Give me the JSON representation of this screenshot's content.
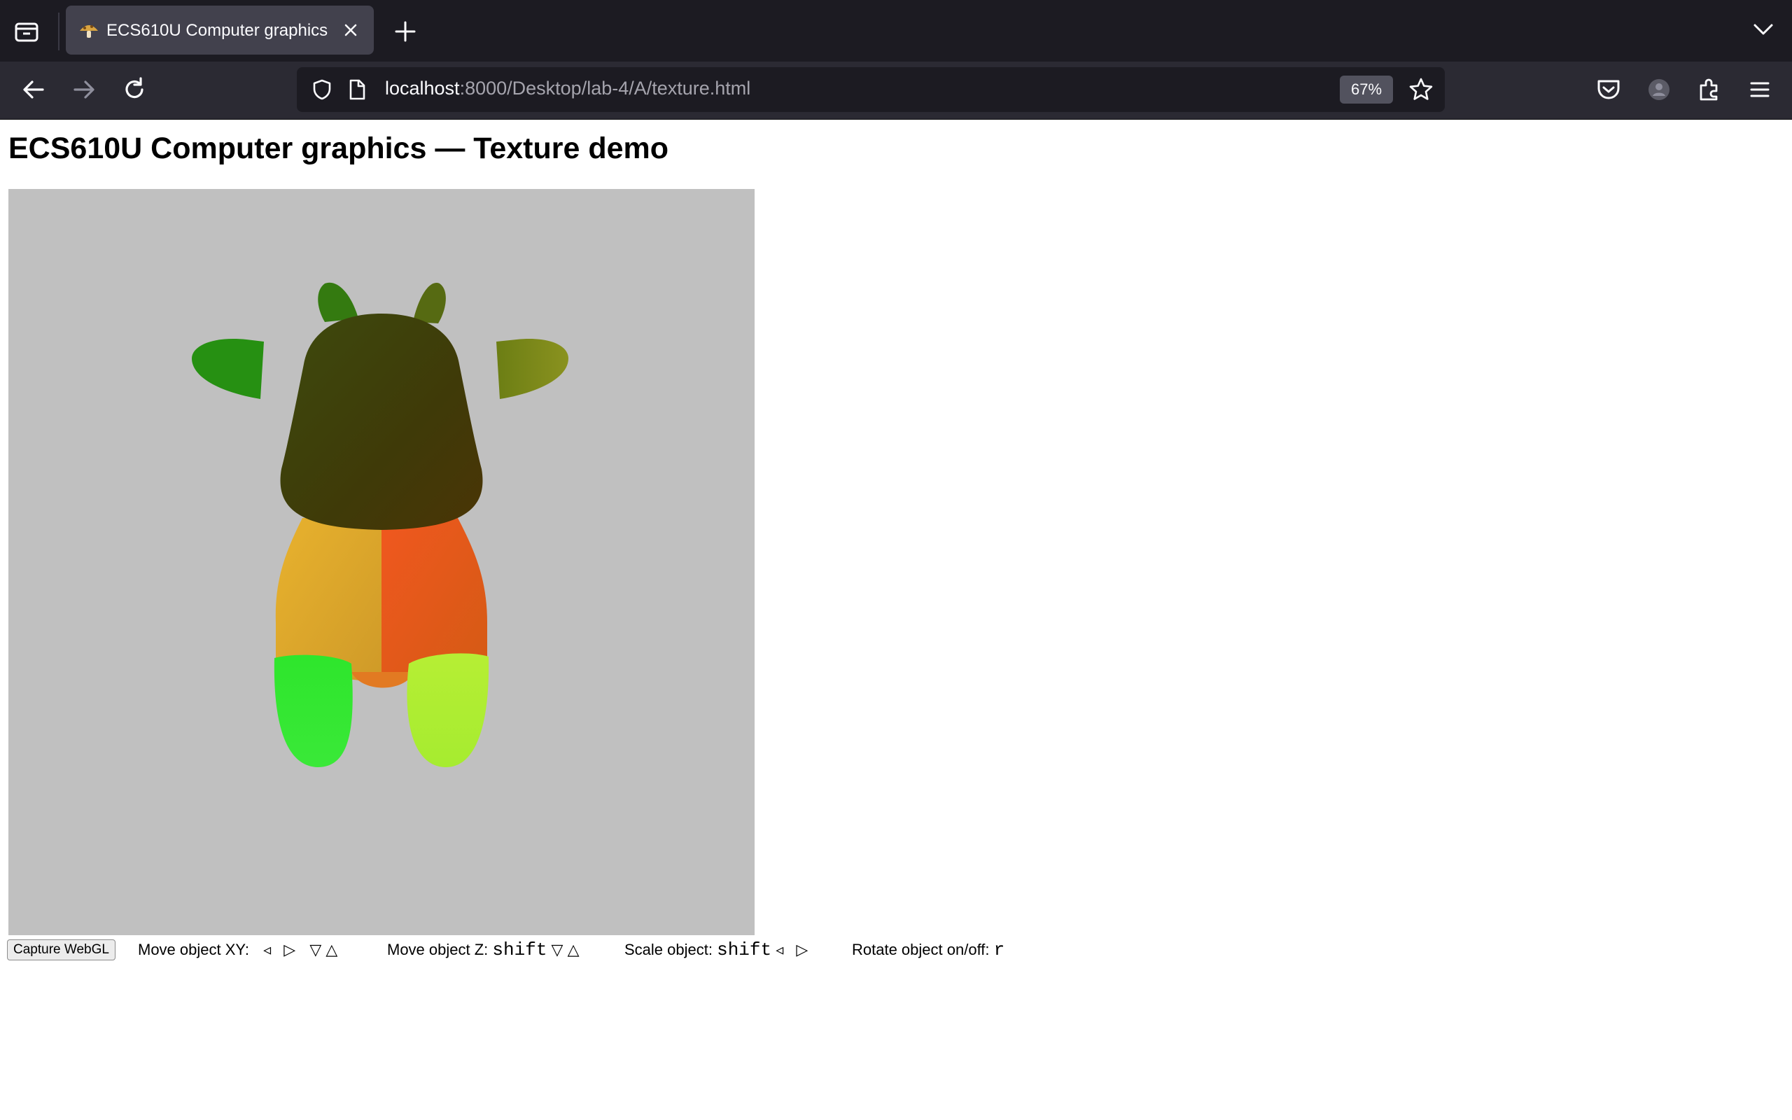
{
  "browser": {
    "tab": {
      "title": "ECS610U Computer graphics",
      "favicon": "mushroom-icon"
    },
    "url": {
      "host": "localhost",
      "rest": ":8000/Desktop/lab-4/A/texture.html"
    },
    "zoom": "67%",
    "icons": [
      "tab-list-icon",
      "close-icon",
      "plus-icon",
      "chevron-down-icon",
      "back-arrow-icon",
      "forward-arrow-icon",
      "reload-icon",
      "shield-icon",
      "page-icon",
      "star-icon",
      "pocket-icon",
      "account-icon",
      "extensions-icon",
      "menu-icon"
    ],
    "colors": {
      "tabbar": "#1c1b22",
      "navbar": "#2b2a33",
      "selected_tab": "#42414d"
    }
  },
  "page": {
    "title": "ECS610U Computer graphics — Texture demo",
    "canvas": {
      "background": "#c0c0c0",
      "content": "cow-model"
    },
    "controls": {
      "capture_label": "Capture WebGL",
      "move_xy": {
        "label": "Move object XY:",
        "left": "◃",
        "right": "▷",
        "down": "▽",
        "up": "△"
      },
      "move_z": {
        "label": "Move object Z:",
        "modifier": "shift",
        "down": "▽",
        "up": "△"
      },
      "scale": {
        "label": "Scale object:",
        "modifier": "shift",
        "left": "◃",
        "right": "▷"
      },
      "rotate": {
        "label": "Rotate object on/off:",
        "key": "r"
      }
    }
  }
}
